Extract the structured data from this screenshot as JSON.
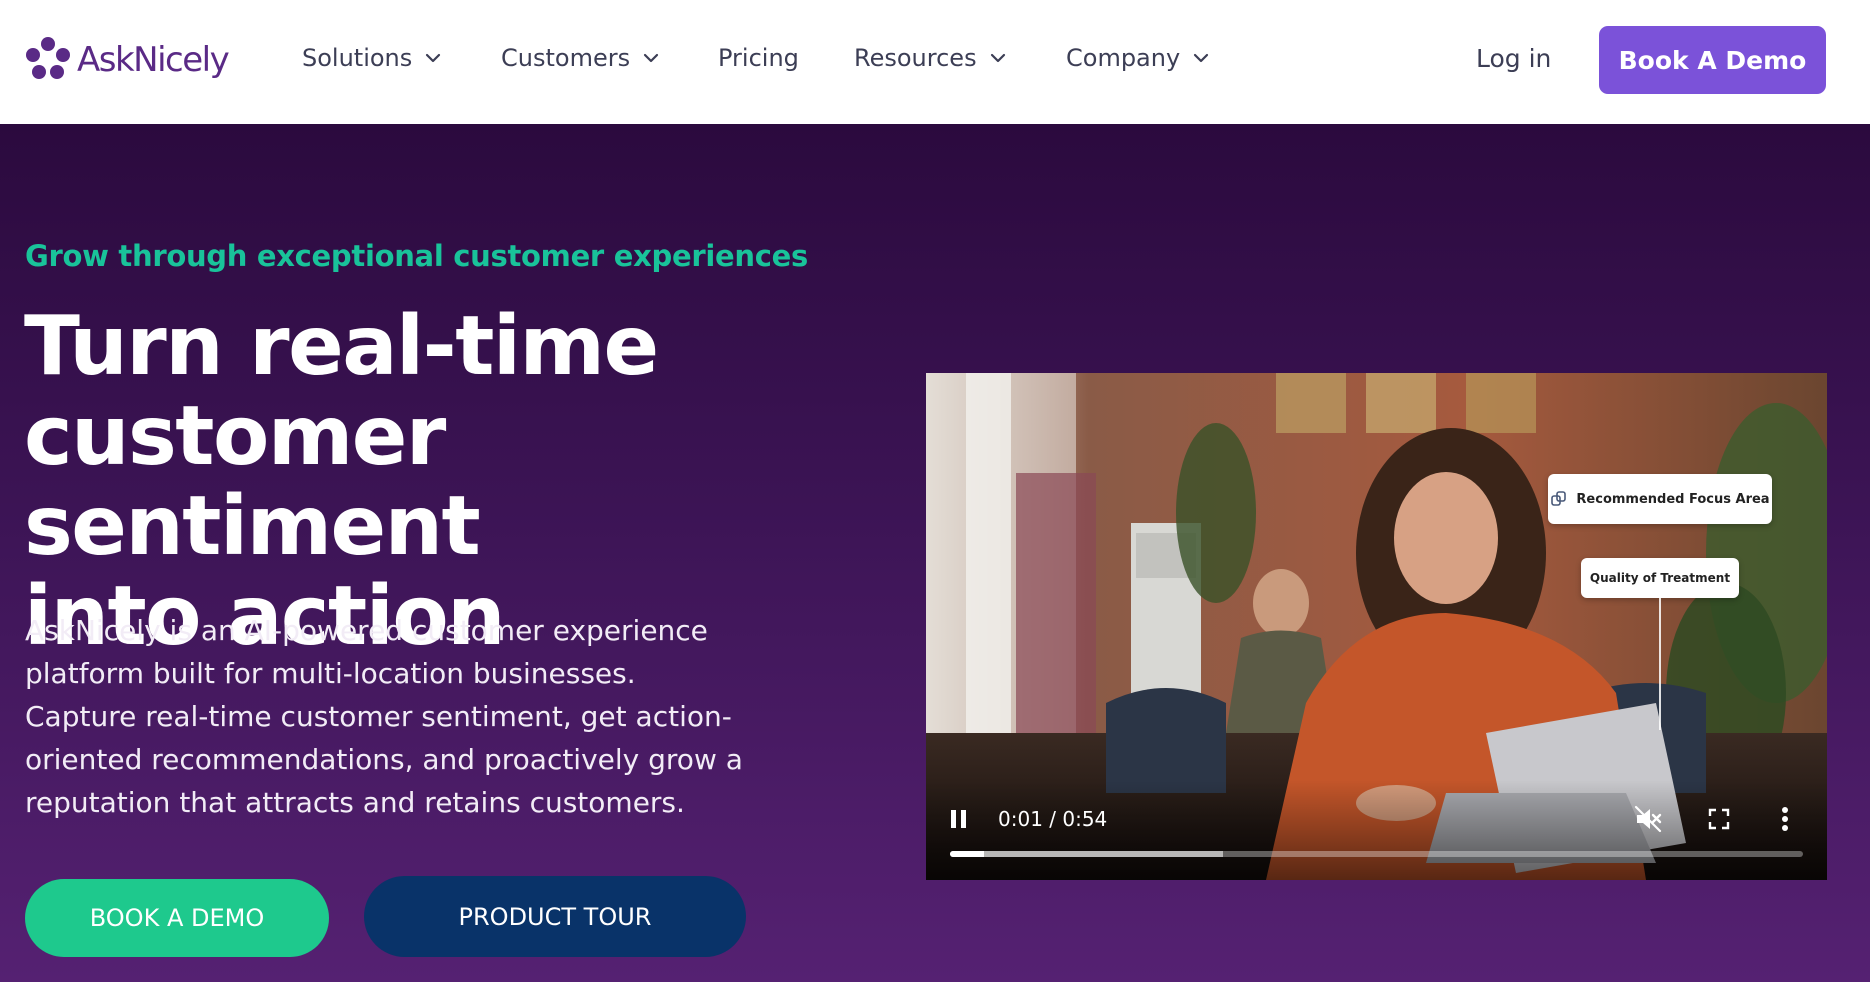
{
  "brand": {
    "name": "AskNicely",
    "logo_color": "#5a2a86"
  },
  "nav": {
    "items": [
      {
        "label": "Solutions",
        "has_dropdown": true
      },
      {
        "label": "Customers",
        "has_dropdown": true
      },
      {
        "label": "Pricing",
        "has_dropdown": false
      },
      {
        "label": "Resources",
        "has_dropdown": true
      },
      {
        "label": "Company",
        "has_dropdown": true
      }
    ],
    "login_label": "Log in",
    "cta_label": "Book A Demo",
    "cta_color": "#7b52d9"
  },
  "hero": {
    "eyebrow": "Grow through exceptional customer experiences",
    "headline_lines": [
      "Turn real-time",
      "customer sentiment",
      "into action"
    ],
    "description_lines": [
      "AskNicely is an AI-powered customer experience",
      "platform built for multi-location businesses.",
      "Capture real-time customer sentiment, get action-",
      "oriented recommendations, and proactively grow a",
      "reputation that attracts and retains customers."
    ],
    "primary_cta": "BOOK A DEMO",
    "secondary_cta": "PRODUCT TOUR",
    "accent_green": "#19c39a",
    "primary_cta_color": "#1ec98d",
    "secondary_cta_color": "#093369"
  },
  "video": {
    "time_display": "0:01 / 0:54",
    "progress_played": 0.04,
    "progress_buffered": 0.32,
    "overlay_tags": [
      "Recommended Focus Area",
      "Quality of Treatment"
    ],
    "state": "playing",
    "muted": true,
    "icons": [
      "pause-icon",
      "muted-speaker-icon",
      "fullscreen-icon",
      "more-vertical-icon"
    ]
  }
}
